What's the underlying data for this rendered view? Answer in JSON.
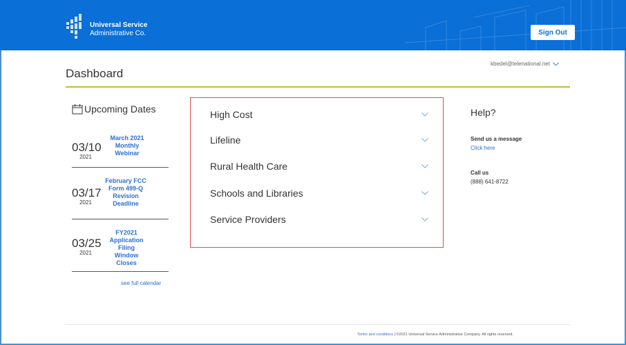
{
  "header": {
    "logo_line1": "Universal Service",
    "logo_line2": "Administrative Co.",
    "signout_label": "Sign Out",
    "brand_color": "#0a6fd6"
  },
  "page": {
    "title": "Dashboard",
    "user_email": "kbedel@telenational.net"
  },
  "upcoming": {
    "heading": "Upcoming Dates",
    "items": [
      {
        "date": "03/10",
        "year": "2021",
        "title": "March 2021 Monthly Webinar"
      },
      {
        "date": "03/17",
        "year": "2021",
        "title": "February FCC Form 499-Q Revision Deadline"
      },
      {
        "date": "03/25",
        "year": "2021",
        "title": "FY2021 Application Filing Window Closes"
      }
    ],
    "see_full_calendar": "see full calendar"
  },
  "programs": {
    "items": [
      {
        "label": "High Cost"
      },
      {
        "label": "Lifeline"
      },
      {
        "label": "Rural Health Care"
      },
      {
        "label": "Schools and Libraries"
      },
      {
        "label": "Service Providers"
      }
    ]
  },
  "help": {
    "title": "Help?",
    "message_label": "Send us a message",
    "message_link": "Click here",
    "call_label": "Call us",
    "phone": "(888) 641-8722"
  },
  "footer": {
    "terms_link": "Terms and conditions",
    "copyright": " | ©2021 Universal Service Administrative Company. All rights reserved."
  }
}
